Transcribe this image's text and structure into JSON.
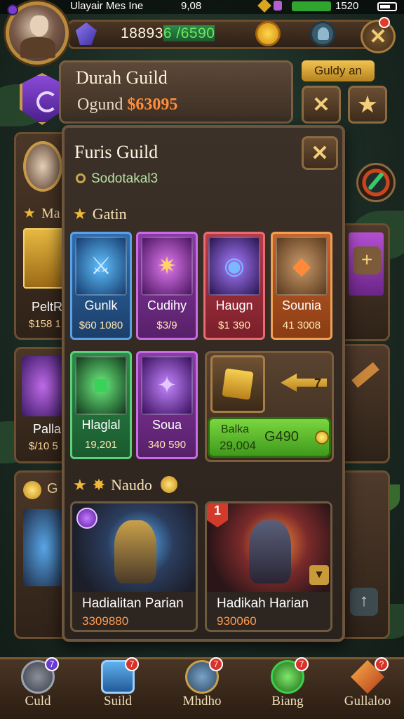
{
  "status_bar": {
    "left_text": "Ulayair Mes Ine",
    "center_text": "9,08",
    "right_text": "1520"
  },
  "hud": {
    "currency_text_a": "18893",
    "currency_text_b": "6 /6590",
    "close_glyph": "✕"
  },
  "back_panel": {
    "title": "Durah Guild",
    "sub_label": "Ogund",
    "sub_amount": "$63095",
    "tag": "Guldy an"
  },
  "side_cards": {
    "label_ma": "Ma",
    "card1_name": "PeltR",
    "card1_price": "$158 1",
    "card2_name": "Palla",
    "card2_price": "$/10 5",
    "label_g": "G"
  },
  "modal": {
    "title": "Furis Guild",
    "subtitle": "Sodotakal3",
    "section1": "Gatin",
    "section2": "Naudo",
    "items_row1": [
      {
        "name": "Gunlk",
        "price": "$60 1080"
      },
      {
        "name": "Cudihy",
        "price": "$3/9"
      },
      {
        "name": "Haugn",
        "price": "$1 390"
      },
      {
        "name": "Sounia",
        "price": "41 3008"
      }
    ],
    "items_row2": [
      {
        "name": "Hlaglal",
        "price": "19,201"
      },
      {
        "name": "Soua",
        "price": "340 590"
      }
    ],
    "trade": {
      "label_top": "Balka",
      "label_bottom": "29,004",
      "price": "G490",
      "arrow_badge": "7"
    },
    "heroes": [
      {
        "name": "Hadialitan Parian",
        "price": "3309880",
        "tag": ""
      },
      {
        "name": "Hadikah Harian",
        "price": "930060",
        "tag": "1"
      }
    ]
  },
  "bottom_nav": [
    {
      "label": "Culd",
      "badge": "7"
    },
    {
      "label": "Suild",
      "badge": "7"
    },
    {
      "label": "Mhdho",
      "badge": "7"
    },
    {
      "label": "Biang",
      "badge": "7"
    },
    {
      "label": "Gullaloo",
      "badge": "?"
    }
  ],
  "colors": {
    "accent_gold": "#f2c552",
    "price_orange": "#ff8c3a",
    "buy_green": "#7bd63f"
  }
}
